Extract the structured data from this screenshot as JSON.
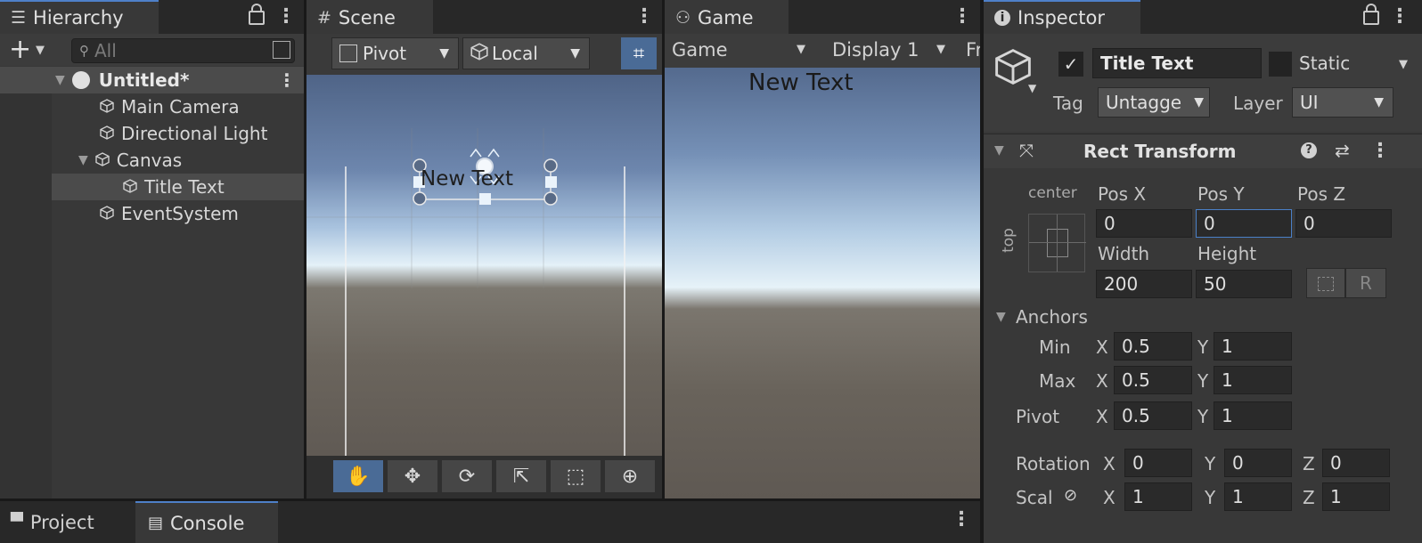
{
  "hierarchy": {
    "tab_label": "Hierarchy",
    "search_placeholder": "All",
    "add_label": "+",
    "scene_name": "Untitled*",
    "items": [
      {
        "label": "Main Camera"
      },
      {
        "label": "Directional Light"
      },
      {
        "label": "Canvas"
      },
      {
        "label": "Title Text"
      },
      {
        "label": "EventSystem"
      }
    ]
  },
  "scene": {
    "tab_label": "Scene",
    "pivot_label": "Pivot",
    "local_label": "Local",
    "overlay_text": "New Text"
  },
  "game": {
    "tab_label": "Game",
    "mode_label": "Game",
    "display_label": "Display 1",
    "cut_label": "Fr",
    "overlay_text": "New Text"
  },
  "inspector": {
    "tab_label": "Inspector",
    "object_name": "Title Text",
    "static_label": "Static",
    "tag_label": "Tag",
    "tag_value": "Untagge",
    "layer_label": "Layer",
    "layer_value": "UI",
    "component_title": "Rect Transform",
    "anchor_h": "center",
    "anchor_v": "top",
    "pos_x_label": "Pos X",
    "pos_y_label": "Pos Y",
    "pos_z_label": "Pos Z",
    "pos_x": "0",
    "pos_y": "0",
    "pos_z": "0",
    "width_label": "Width",
    "height_label": "Height",
    "width": "200",
    "height": "50",
    "r_label": "R",
    "anchors_label": "Anchors",
    "min_label": "Min",
    "max_label": "Max",
    "pivot_label": "Pivot",
    "x_label": "X",
    "y_label": "Y",
    "z_label": "Z",
    "min_x": "0.5",
    "min_y": "1",
    "max_x": "0.5",
    "max_y": "1",
    "pivot_x": "0.5",
    "pivot_y": "1",
    "rotation_label": "Rotation",
    "rot_x": "0",
    "rot_y": "0",
    "rot_z": "0",
    "scale_label": "Scal",
    "scale_x": "1",
    "scale_y": "1",
    "scale_z": "1"
  },
  "bottom": {
    "project_label": "Project",
    "console_label": "Console"
  }
}
